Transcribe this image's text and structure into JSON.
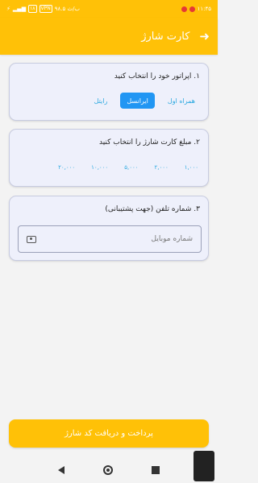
{
  "status_bar": {
    "time": "۱۱:۴۵",
    "network_speed": "۹۸.۵ ب/ث",
    "vpn": "VPN",
    "battery": "۱۸"
  },
  "app_bar": {
    "title": "کارت شارژ",
    "back_icon": "arrow-left-icon"
  },
  "operator_section": {
    "title": "۱. اپراتور خود را انتخاب کنید",
    "options": [
      "همراه اول",
      "ایرانسل",
      "رایتل"
    ],
    "selected": "ایرانسل"
  },
  "amount_section": {
    "title": "۲. مبلغ کارت شارژ را انتخاب کنید",
    "options": [
      "۱,۰۰۰",
      "۲,۰۰۰",
      "۵,۰۰۰",
      "۱۰,۰۰۰",
      "۲۰,۰۰۰"
    ]
  },
  "phone_section": {
    "title": "۳. شماره تلفن (جهت پشتیبانی)",
    "placeholder": "شماره موبایل",
    "value": ""
  },
  "pay_button": {
    "label": "پرداخت و دریافت کد شارژ"
  },
  "colors": {
    "accent": "#ffc107",
    "selected": "#2196f3",
    "link": "#29a8e0"
  }
}
